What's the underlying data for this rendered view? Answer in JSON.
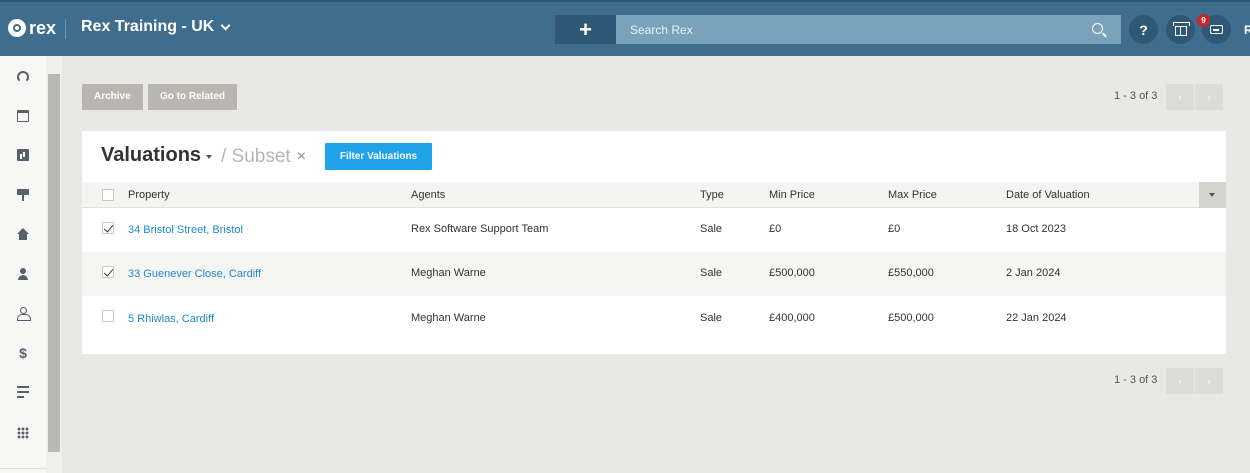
{
  "topbar": {
    "logo_text": "rex",
    "account_name": "Rex Training - UK",
    "add_label": "+",
    "search_placeholder": "Search Rex",
    "help_label": "?",
    "notification_count": "9",
    "user_initial": "R"
  },
  "sidebar": {
    "items": [
      {
        "icon": "dashboard-icon"
      },
      {
        "icon": "calendar-icon"
      },
      {
        "icon": "reports-icon"
      },
      {
        "icon": "listings-sign-icon"
      },
      {
        "icon": "properties-house-icon"
      },
      {
        "icon": "contacts-person-icon"
      },
      {
        "icon": "owners-person-icon"
      },
      {
        "icon": "financials-dollar-icon"
      },
      {
        "icon": "lists-icon"
      },
      {
        "icon": "apps-grid-icon"
      }
    ]
  },
  "toolbar": {
    "archive_label": "Archive",
    "go_to_related_label": "Go to Related",
    "pagination_top": "1 - 3 of 3",
    "pagination_bottom": "1 - 3 of 3",
    "prev_label": "‹",
    "next_label": "›"
  },
  "list": {
    "title": "Valuations",
    "subset_label": "/ Subset",
    "subset_close": "×",
    "filter_label": "Filter Valuations",
    "columns": [
      "Property",
      "Agents",
      "Type",
      "Min Price",
      "Max Price",
      "Date of Valuation"
    ],
    "rows": [
      {
        "checked": true,
        "property": "34 Bristol Street, Bristol",
        "agents": "Rex Software Support Team",
        "type": "Sale",
        "min_price": "£0",
        "max_price": "£0",
        "date": "18 Oct 2023"
      },
      {
        "checked": true,
        "property": "33 Guenever Close, Cardiff",
        "agents": "Meghan Warne",
        "type": "Sale",
        "min_price": "£500,000",
        "max_price": "£550,000",
        "date": "2 Jan 2024"
      },
      {
        "checked": false,
        "property": "5 Rhiwlas, Cardiff",
        "agents": "Meghan Warne",
        "type": "Sale",
        "min_price": "£400,000",
        "max_price": "£500,000",
        "date": "22 Jan 2024"
      }
    ]
  },
  "colors": {
    "topbar": "#3f6d8d",
    "accent_blue": "#1ea2e8",
    "link": "#1e8ad0",
    "badge": "#c62828"
  }
}
